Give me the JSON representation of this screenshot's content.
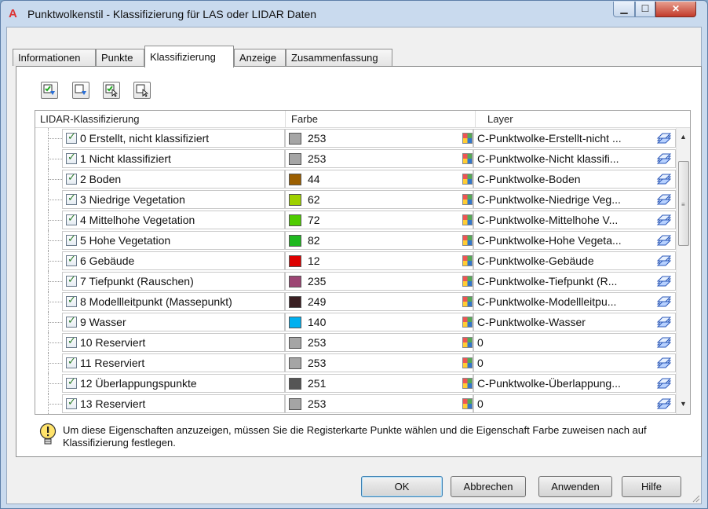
{
  "window": {
    "title": "Punktwolkenstil - Klassifizierung für LAS oder LIDAR Daten",
    "app_icon": "A"
  },
  "tabs": [
    {
      "label": "Informationen",
      "active": false
    },
    {
      "label": "Punkte",
      "active": false
    },
    {
      "label": "Klassifizierung",
      "active": true
    },
    {
      "label": "Anzeige",
      "active": false
    },
    {
      "label": "Zusammenfassung",
      "active": false
    }
  ],
  "toolbar_icons": [
    "check-all-icon",
    "uncheck-all-icon",
    "check-selected-icon",
    "uncheck-selected-icon"
  ],
  "grid": {
    "headers": {
      "classification": "LIDAR-Klassifizierung",
      "color": "Farbe",
      "layer": "Layer"
    },
    "rows": [
      {
        "label": "0 Erstellt, nicht klassifiziert",
        "color_num": "253",
        "color_hex": "#a5a5a5",
        "layer": "C-Punktwolke-Erstellt-nicht ..."
      },
      {
        "label": "1 Nicht klassifiziert",
        "color_num": "253",
        "color_hex": "#a5a5a5",
        "layer": "C-Punktwolke-Nicht klassifi..."
      },
      {
        "label": "2 Boden",
        "color_num": "44",
        "color_hex": "#9c5f00",
        "layer": "C-Punktwolke-Boden"
      },
      {
        "label": "3 Niedrige Vegetation",
        "color_num": "62",
        "color_hex": "#9ed100",
        "layer": "C-Punktwolke-Niedrige Veg..."
      },
      {
        "label": "4 Mittelhohe Vegetation",
        "color_num": "72",
        "color_hex": "#4fcc00",
        "layer": "C-Punktwolke-Mittelhohe V..."
      },
      {
        "label": "5 Hohe Vegetation",
        "color_num": "82",
        "color_hex": "#1fb81f",
        "layer": "C-Punktwolke-Hohe Vegeta..."
      },
      {
        "label": "6 Gebäude",
        "color_num": "12",
        "color_hex": "#dd0000",
        "layer": "C-Punktwolke-Gebäude"
      },
      {
        "label": "7 Tiefpunkt (Rauschen)",
        "color_num": "235",
        "color_hex": "#9c4573",
        "layer": "C-Punktwolke-Tiefpunkt (R..."
      },
      {
        "label": "8 Modellleitpunkt (Massepunkt)",
        "color_num": "249",
        "color_hex": "#3a1f22",
        "layer": "C-Punktwolke-Modellleitpu..."
      },
      {
        "label": "9 Wasser",
        "color_num": "140",
        "color_hex": "#00b0f0",
        "layer": "C-Punktwolke-Wasser"
      },
      {
        "label": "10 Reserviert",
        "color_num": "253",
        "color_hex": "#a5a5a5",
        "layer": "0"
      },
      {
        "label": "11 Reserviert",
        "color_num": "253",
        "color_hex": "#a5a5a5",
        "layer": "0"
      },
      {
        "label": "12 Überlappungspunkte",
        "color_num": "251",
        "color_hex": "#555555",
        "layer": "C-Punktwolke-Überlappung..."
      },
      {
        "label": "13 Reserviert",
        "color_num": "253",
        "color_hex": "#a5a5a5",
        "layer": "0"
      }
    ]
  },
  "info_text": "Um diese Eigenschaften anzuzeigen, müssen Sie die Registerkarte Punkte wählen und die Eigenschaft Farbe zuweisen nach auf Klassifizierung festlegen.",
  "buttons": {
    "ok": "OK",
    "cancel": "Abbrechen",
    "apply": "Anwenden",
    "help": "Hilfe"
  }
}
